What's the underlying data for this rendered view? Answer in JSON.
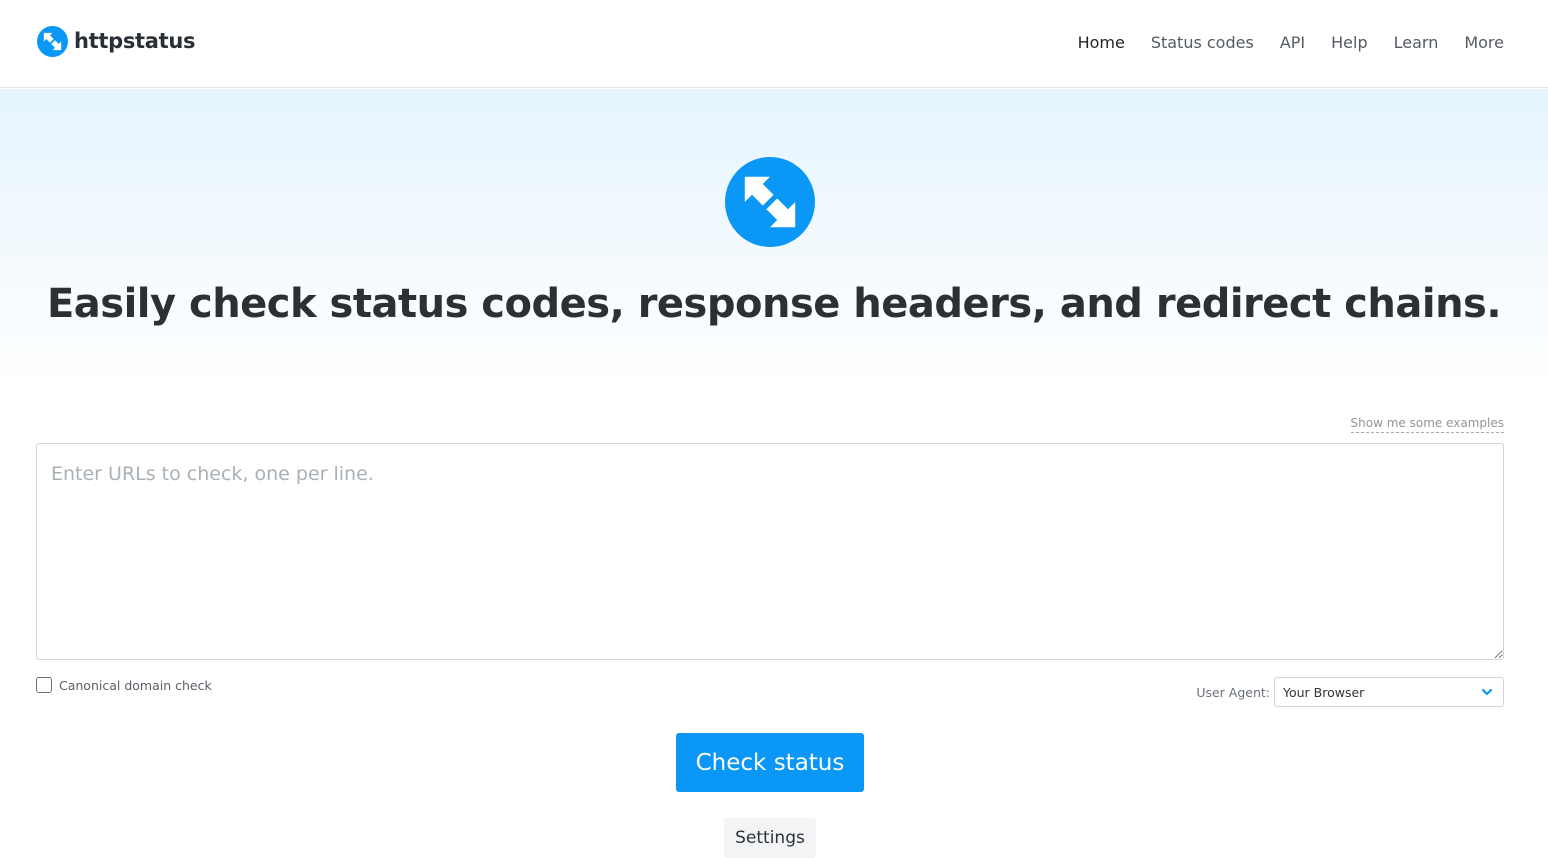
{
  "brand": {
    "name": "httpstatus",
    "icon": "arrows-exchange-icon",
    "accent_color": "#0a97f5"
  },
  "nav": {
    "items": [
      {
        "label": "Home",
        "active": true
      },
      {
        "label": "Status codes",
        "active": false
      },
      {
        "label": "API",
        "active": false
      },
      {
        "label": "Help",
        "active": false
      },
      {
        "label": "Learn",
        "active": false
      },
      {
        "label": "More",
        "active": false
      }
    ]
  },
  "hero": {
    "icon": "arrows-exchange-icon",
    "headline_parts": [
      {
        "text": "Easily check ",
        "bold": false
      },
      {
        "text": "status codes",
        "bold": true
      },
      {
        "text": ", ",
        "bold": false
      },
      {
        "text": "response headers",
        "bold": true
      },
      {
        "text": ", and ",
        "bold": false
      },
      {
        "text": "redirect chains",
        "bold": true
      },
      {
        "text": ".",
        "bold": false
      }
    ]
  },
  "form": {
    "examples_link": "Show me some examples",
    "urls_value": "",
    "urls_placeholder": "Enter URLs to check, one per line.",
    "canonical_label": "Canonical domain check",
    "canonical_checked": false,
    "user_agent_label": "User Agent:",
    "user_agent_value": "Your Browser",
    "check_button": "Check status",
    "settings_button": "Settings"
  }
}
